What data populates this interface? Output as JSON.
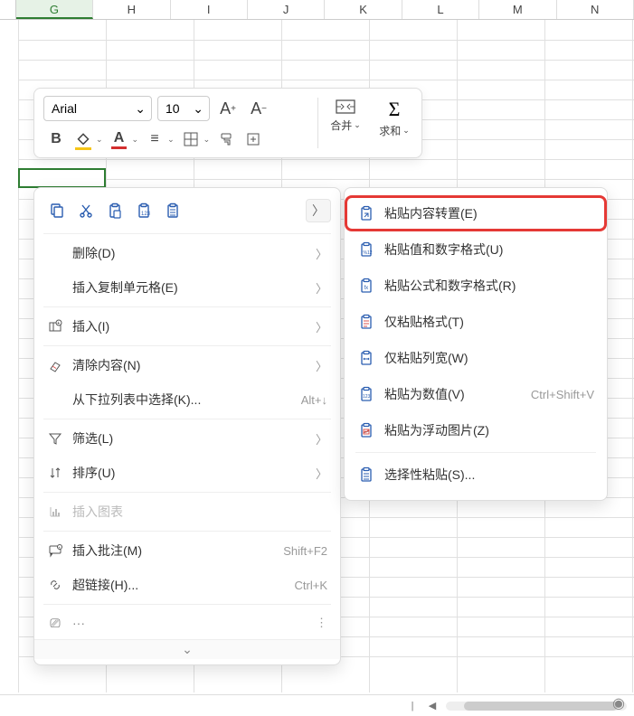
{
  "columns": [
    "G",
    "H",
    "I",
    "J",
    "K",
    "L",
    "M",
    "N"
  ],
  "active_col_index": 0,
  "toolbar": {
    "font_name": "Arial",
    "font_size": "10",
    "merge_label": "合并",
    "sum_label": "求和"
  },
  "ctx": {
    "delete": "删除(D)",
    "insert_copied": "插入复制单元格(E)",
    "insert": "插入(I)",
    "clear": "清除内容(N)",
    "dropdown_pick": "从下拉列表中选择(K)...",
    "dropdown_pick_shortcut": "Alt+↓",
    "filter": "筛选(L)",
    "sort": "排序(U)",
    "insert_chart": "插入图表",
    "insert_comment": "插入批注(M)",
    "insert_comment_shortcut": "Shift+F2",
    "hyperlink": "超链接(H)...",
    "hyperlink_shortcut": "Ctrl+K"
  },
  "sub": {
    "paste_transpose": "粘贴内容转置(E)",
    "paste_values_num": "粘贴值和数字格式(U)",
    "paste_formula_num": "粘贴公式和数字格式(R)",
    "paste_format_only": "仅粘贴格式(T)",
    "paste_col_width": "仅粘贴列宽(W)",
    "paste_as_values": "粘贴为数值(V)",
    "paste_as_values_shortcut": "Ctrl+Shift+V",
    "paste_as_image": "粘贴为浮动图片(Z)",
    "paste_special": "选择性粘贴(S)..."
  }
}
